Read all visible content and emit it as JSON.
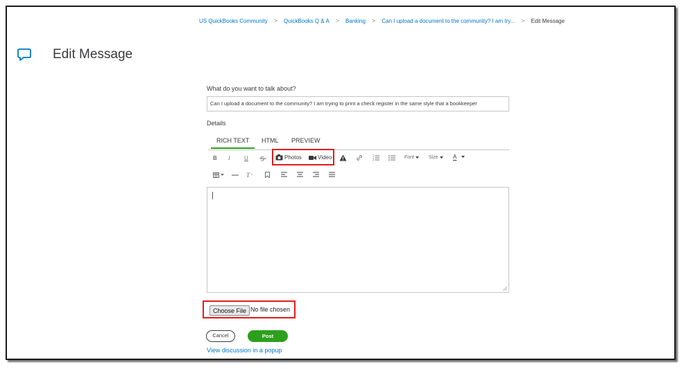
{
  "breadcrumb": {
    "items": [
      "US QuickBooks Community",
      "QuickBooks Q & A",
      "Banking",
      "Can I upload a document to the community? I am try...",
      "Edit Message"
    ],
    "separator": ">"
  },
  "page": {
    "title": "Edit Message"
  },
  "form": {
    "subject_label": "What do you want to talk about?",
    "subject_value": "Can I upload a document to the community? I am trying to print a check register in the same style that a bookkeeper",
    "details_label": "Details",
    "tabs": [
      "RICH TEXT",
      "HTML",
      "PREVIEW"
    ],
    "active_tab": "RICH TEXT",
    "toolbar": {
      "bold": "B",
      "italic": "I",
      "underline": "U",
      "photos": "Photos",
      "video": "Video",
      "font": "Font",
      "size": "Size",
      "text_color": "A",
      "clear_format": "T"
    },
    "file": {
      "button_label": "Choose File",
      "status": "No file chosen"
    },
    "cancel_label": "Cancel",
    "post_label": "Post",
    "popup_link": "View discussion in a popup"
  },
  "colors": {
    "accent": "#2ca01c",
    "link": "#0077c5",
    "highlight": "#e41b1b"
  }
}
